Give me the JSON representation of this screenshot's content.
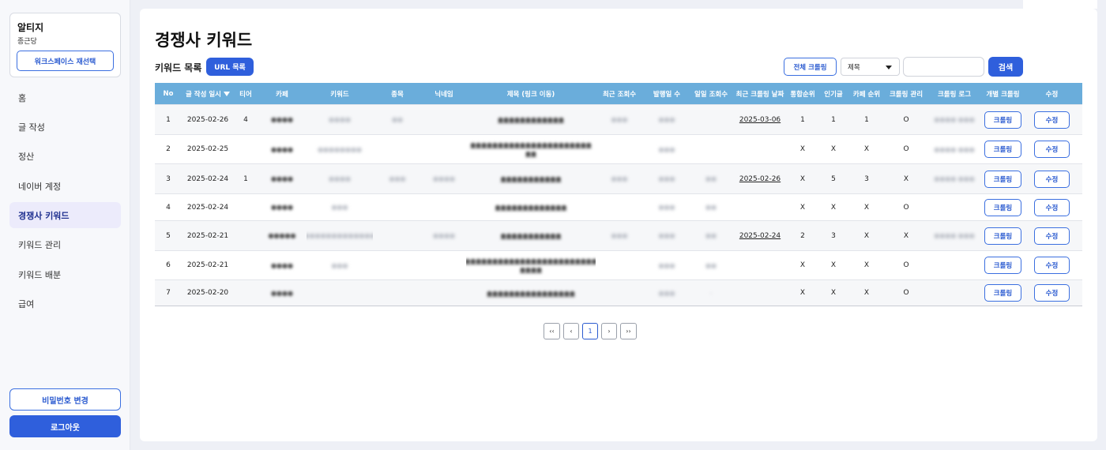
{
  "sidebar": {
    "workspace_name": "알티지",
    "workspace_sub": "종근당",
    "reselect_label": "워크스페이스 재선택",
    "nav": [
      "홈",
      "글 작성",
      "정산",
      "네이버 계정",
      "경쟁사 키워드",
      "키워드 관리",
      "키워드 배분",
      "급여"
    ],
    "active_index": 4,
    "change_password_label": "비밀번호 변경",
    "logout_label": "로그아웃"
  },
  "header": {
    "title": "경쟁사 키워드",
    "list_label": "키워드 목록",
    "url_list_label": "URL 목록",
    "crawl_all_label": "전체 크롤링",
    "select_value": "제목",
    "search_placeholder": "",
    "search_label": "검색"
  },
  "table": {
    "columns": [
      "No",
      "글 작성 일시",
      "티어",
      "카페",
      "키워드",
      "종목",
      "닉네임",
      "제목 (링크 이동)",
      "최근 조회수",
      "발행일 수",
      "일일 조회수",
      "최근 크롤링 날짜",
      "통합순위",
      "인기글",
      "카페 순위",
      "크롤링 관리",
      "크롤링 로그",
      "개별 크롤링",
      "수정"
    ],
    "crawl_btn_label": "크롤링",
    "edit_btn_label": "수정",
    "rows": [
      {
        "no": "1",
        "date": "2025-02-26",
        "tier": "4",
        "cafe": "●●●●",
        "keyword": "●●●●",
        "item": "●●",
        "nick": "",
        "title": "●●●●●●●●●●●●",
        "views": "●●●",
        "days": "●●●",
        "daily": "",
        "crawl_date": "2025-03-06",
        "rank": "1",
        "popular": "1",
        "cafe_rank": "1",
        "manage": "O",
        "log": "●●●● ●●●"
      },
      {
        "no": "2",
        "date": "2025-02-25",
        "tier": "",
        "cafe": "●●●●",
        "keyword": "●●●●●●●●",
        "item": "",
        "nick": "",
        "title": "●●●●●●●●●●●●●●●●●●●●●●",
        "title2": "●●",
        "views": "",
        "days": "●●●",
        "daily": "",
        "crawl_date": "",
        "rank": "X",
        "popular": "X",
        "cafe_rank": "X",
        "manage": "O",
        "log": "●●●● ●●●"
      },
      {
        "no": "3",
        "date": "2025-02-24",
        "tier": "1",
        "cafe": "●●●●",
        "keyword": "●●●●",
        "item": "●●●",
        "nick": "●●●●",
        "title": "●●●●●●●●●●●",
        "views": "●●●",
        "days": "●●●",
        "daily": "●●",
        "crawl_date": "2025-02-26",
        "rank": "X",
        "popular": "5",
        "cafe_rank": "3",
        "manage": "X",
        "log": "●●●● ●●●"
      },
      {
        "no": "4",
        "date": "2025-02-24",
        "tier": "",
        "cafe": "●●●●",
        "keyword": "●●●",
        "item": "",
        "nick": "",
        "title": "●●●●●●●●●●●●●",
        "views": "",
        "days": "●●●",
        "daily": "●●",
        "crawl_date": "",
        "rank": "X",
        "popular": "X",
        "cafe_rank": "X",
        "manage": "O",
        "log": ""
      },
      {
        "no": "5",
        "date": "2025-02-21",
        "tier": "",
        "cafe": "●●●●●",
        "keyword": "●●●●●●●●●●●●●",
        "item": "",
        "nick": "●●●●",
        "title": "●●●●●●●●●●●",
        "views": "●●●",
        "days": "●●●",
        "daily": "●●",
        "crawl_date": "2025-02-24",
        "rank": "2",
        "popular": "3",
        "cafe_rank": "X",
        "manage": "X",
        "log": "●●●● ●●●"
      },
      {
        "no": "6",
        "date": "2025-02-21",
        "tier": "",
        "cafe": "●●●●",
        "keyword": "●●●",
        "item": "",
        "nick": "",
        "title": "●●●●●●●●●●●●●●●●●●●●●●●●",
        "title2": "●●●●",
        "views": "",
        "days": "●●●",
        "daily": "●●",
        "crawl_date": "",
        "rank": "X",
        "popular": "X",
        "cafe_rank": "X",
        "manage": "O",
        "log": ""
      },
      {
        "no": "7",
        "date": "2025-02-20",
        "tier": "",
        "cafe": "●●●●",
        "keyword": "",
        "item": "",
        "nick": "",
        "title": "●●●●●●●●●●●●●●●●",
        "views": "",
        "days": "●●●",
        "daily": "-",
        "crawl_date": "",
        "rank": "X",
        "popular": "X",
        "cafe_rank": "X",
        "manage": "O",
        "log": ""
      }
    ]
  },
  "pagination": {
    "first": "‹‹",
    "prev": "‹",
    "current": "1",
    "next": "›",
    "last": "››"
  },
  "colors": {
    "accent": "#2f5fdc",
    "table_header": "#6aaddb",
    "active_nav": "#ecebfb"
  }
}
